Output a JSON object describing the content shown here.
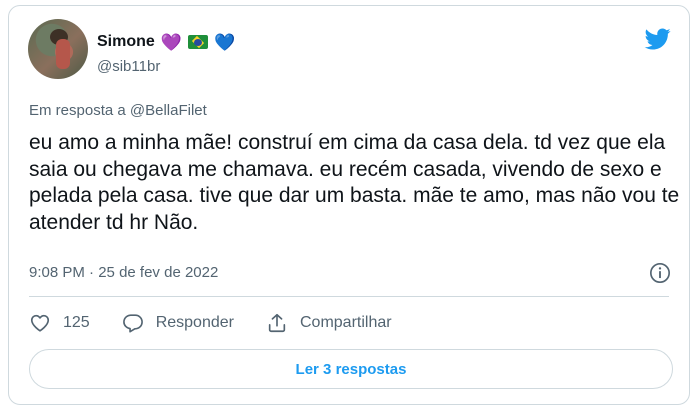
{
  "tweet": {
    "display_name": "Simone",
    "name_emojis": [
      "💜",
      "flag-brazil",
      "💙"
    ],
    "handle": "@sib11br",
    "reply_to_prefix": "Em resposta a",
    "reply_to_user": "@BellaFilet",
    "text": "eu amo a minha mãe! construí em cima da casa dela. td vez que ela saia ou chegava me chamava. eu recém casada, vivendo de sexo e pelada pela casa. tive que dar um basta. mãe te amo, mas não vou te atender td hr Não.",
    "time": "9:08 PM",
    "separator": "·",
    "date": "25 de fev de 2022",
    "like_count": "125",
    "reply_label": "Responder",
    "share_label": "Compartilhar",
    "read_replies_label": "Ler 3 respostas"
  },
  "colors": {
    "brand_blue": "#1d9bf0",
    "text_primary": "#0f1419",
    "text_secondary": "#536471",
    "border": "#cfd9de"
  },
  "icons": [
    "twitter-bird-icon",
    "info-icon",
    "heart-icon",
    "reply-bubble-icon",
    "share-icon"
  ]
}
